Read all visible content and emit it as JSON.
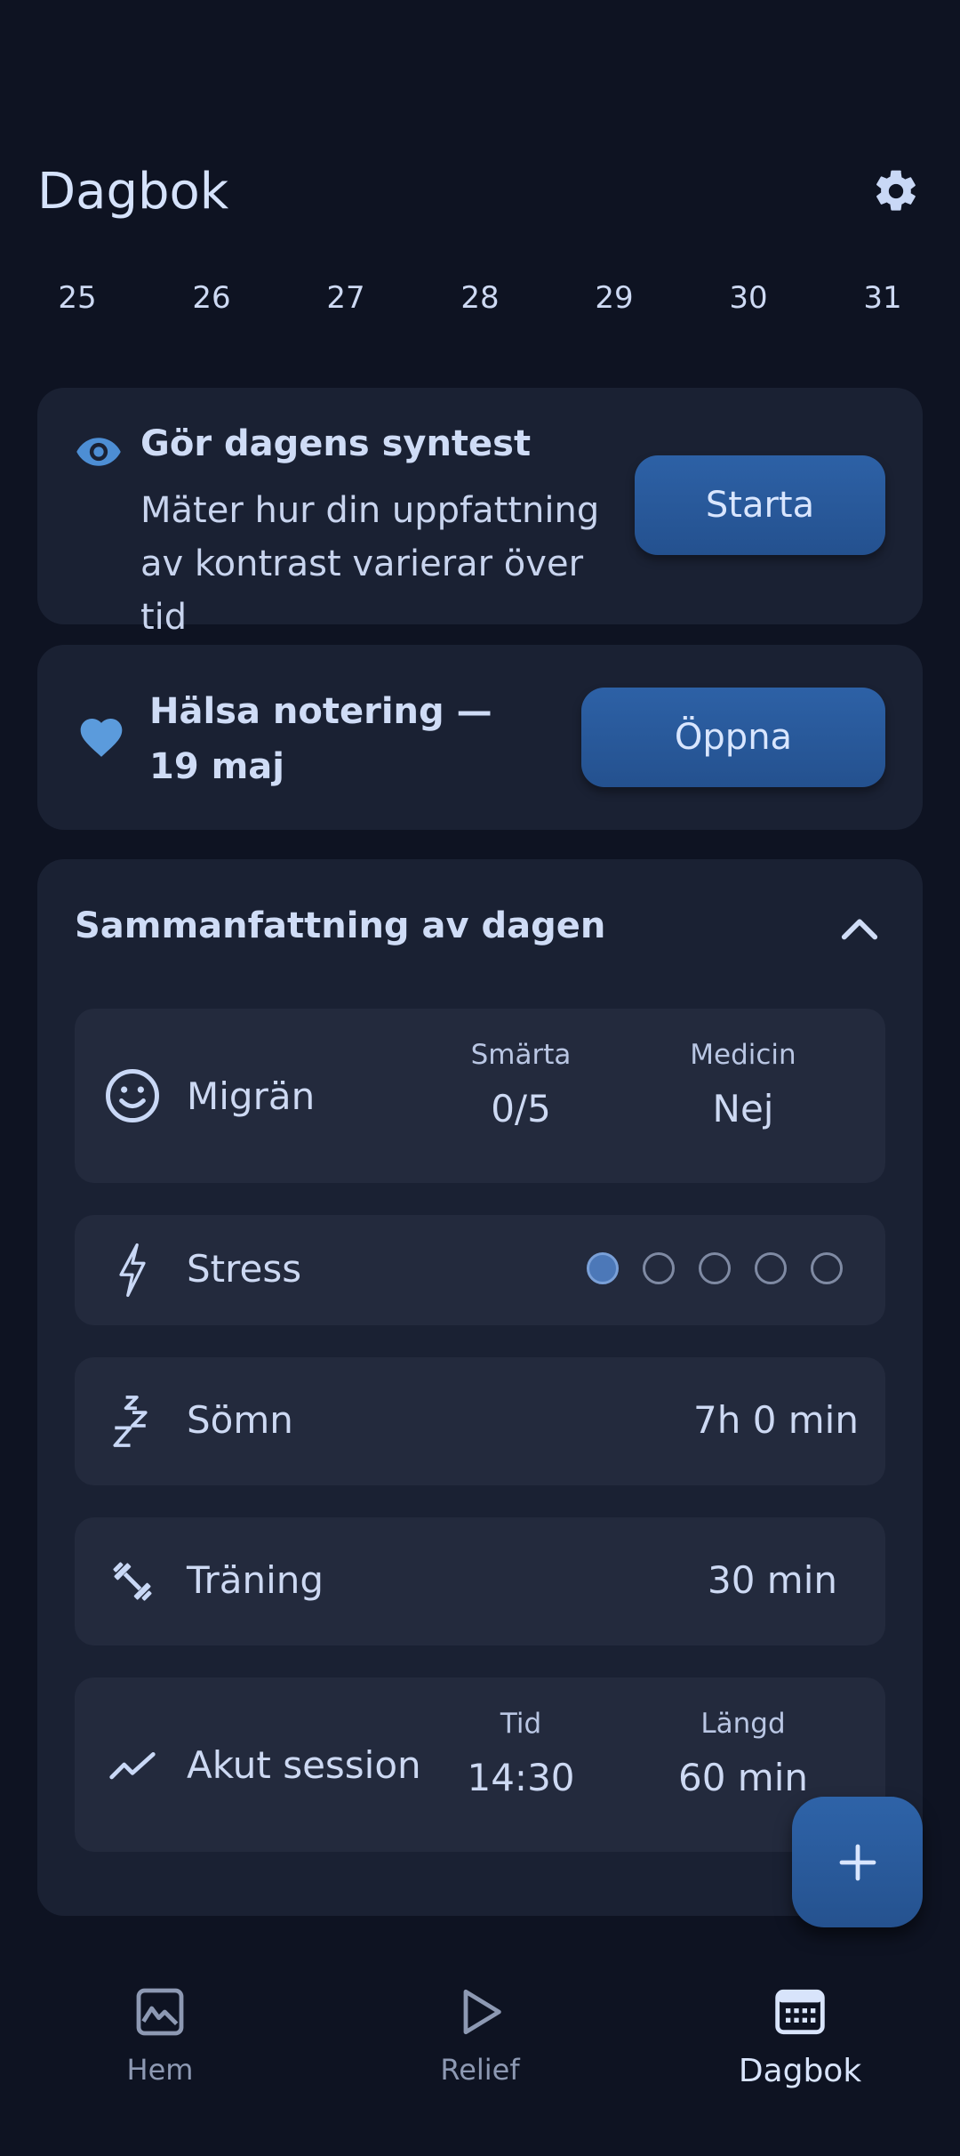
{
  "header": {
    "title": "Dagbok"
  },
  "dates": [
    "25",
    "26",
    "27",
    "28",
    "29",
    "30",
    "31"
  ],
  "syntest": {
    "title": "Gör dagens syntest",
    "description": "Mäter hur din uppfattning av kontrast varierar över tid",
    "button": "Starta"
  },
  "health": {
    "title": "Hälsa notering — 19 maj",
    "button": "Öppna"
  },
  "summary": {
    "title": "Sammanfattning av dagen",
    "migraine": {
      "label": "Migrän",
      "pain_label": "Smärta",
      "pain_value": "0/5",
      "med_label": "Medicin",
      "med_value": "Nej"
    },
    "stress": {
      "label": "Stress",
      "level": 1,
      "max": 5
    },
    "sleep": {
      "label": "Sömn",
      "value": "7h 0 min"
    },
    "training": {
      "label": "Träning",
      "value": "30 min"
    },
    "session": {
      "label": "Akut session",
      "time_label": "Tid",
      "time_value": "14:30",
      "length_label": "Längd",
      "length_value": "60 min"
    }
  },
  "nav": [
    {
      "label": "Hem",
      "icon": "image-chart-icon"
    },
    {
      "label": "Relief",
      "icon": "play-icon"
    },
    {
      "label": "Dagbok",
      "icon": "calendar-icon"
    }
  ],
  "colors": {
    "background": "#0e1322",
    "card": "#1a2133",
    "row": "#232a3d",
    "accent": "#2d61a6",
    "icon": "#5b9bdc"
  }
}
